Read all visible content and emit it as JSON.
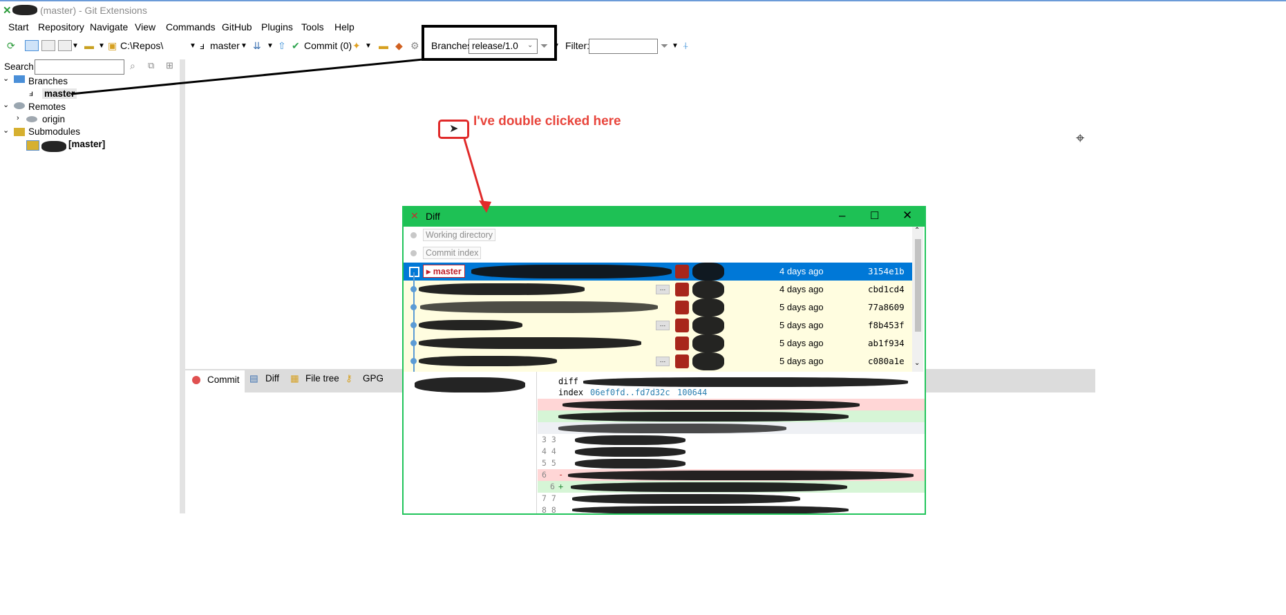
{
  "window": {
    "title": "(master) - Git Extensions"
  },
  "menu": [
    "Start",
    "Repository",
    "Navigate",
    "View",
    "Commands",
    "GitHub",
    "Plugins",
    "Tools",
    "Help"
  ],
  "toolbar": {
    "repo_path": "C:\\Repos\\",
    "branch": "master",
    "commit_label": "Commit (0)",
    "branches_label": "Branches:",
    "branches_value": "release/1.0",
    "filter_label": "Filter:",
    "filter_value": ""
  },
  "search": {
    "label": "Search:",
    "value": ""
  },
  "tree": {
    "branches": "Branches",
    "branch_master": "master",
    "remotes": "Remotes",
    "remote_origin": "origin",
    "submodules": "Submodules",
    "submodule_branch": "[master]"
  },
  "tabs": [
    "Commit",
    "Diff",
    "File tree",
    "GPG"
  ],
  "annotation": {
    "text": "I've double clicked here"
  },
  "diff_window": {
    "title": "Diff",
    "working_directory": "Working directory",
    "commit_index": "Commit index",
    "head_branch": "master",
    "rows": [
      {
        "date": "4 days ago",
        "sha": "3154e1b"
      },
      {
        "date": "4 days ago",
        "sha": "cbd1cd4"
      },
      {
        "date": "5 days ago",
        "sha": "77a8609"
      },
      {
        "date": "5 days ago",
        "sha": "f8b453f"
      },
      {
        "date": "5 days ago",
        "sha": "ab1f934"
      },
      {
        "date": "5 days ago",
        "sha": "c080a1e"
      }
    ],
    "diff": {
      "header": "diff",
      "index_line": "index ",
      "index_hashes": "06ef0fd..fd7d32c",
      "index_mode": "100644",
      "lines": [
        "3 3",
        "4 4",
        "5 5",
        "6",
        "6",
        "7 7",
        "8 8"
      ],
      "del_marker": "-",
      "add_marker": "+"
    }
  },
  "colors": {
    "accent_green": "#1ec155",
    "annotation_red": "#e02a2a",
    "selection_blue": "#0078d7",
    "commit_bg": "#fffde0"
  }
}
